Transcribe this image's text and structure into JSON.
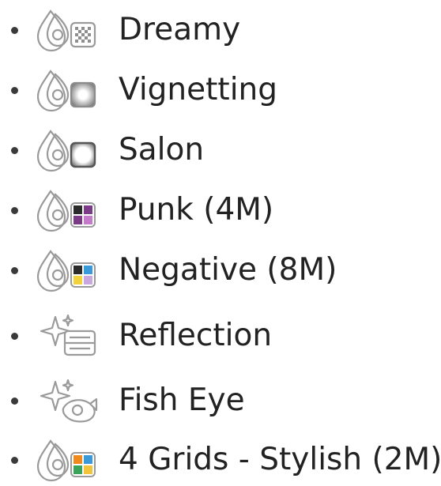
{
  "effects": [
    {
      "label": "Dreamy",
      "icon": "drop-dreamy-swatch-icon"
    },
    {
      "label": "Vignetting",
      "icon": "drop-vignetting-swatch-icon"
    },
    {
      "label": "Salon",
      "icon": "drop-salon-swatch-icon"
    },
    {
      "label": "Punk (4M)",
      "icon": "drop-punk-swatch-icon"
    },
    {
      "label": "Negative (8M)",
      "icon": "drop-negative-swatch-icon"
    },
    {
      "label": "Reflection",
      "icon": "sparkle-reflection-icon"
    },
    {
      "label": "Fish Eye",
      "icon": "sparkle-fisheye-icon"
    },
    {
      "label": "4 Grids - Stylish (2M)",
      "icon": "drop-four-grids-swatch-icon"
    }
  ]
}
